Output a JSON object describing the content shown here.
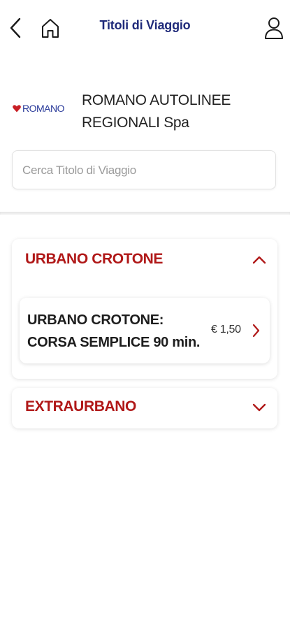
{
  "header": {
    "title": "Titoli di Viaggio",
    "back_icon": "chevron-left-icon",
    "home_icon": "home-icon",
    "user_icon": "user-icon"
  },
  "company": {
    "logo_text": "ROMANO",
    "name": "ROMANO AUTOLINEE REGIONALI Spa"
  },
  "search": {
    "placeholder": "Cerca Titolo di Viaggio",
    "value": ""
  },
  "categories": [
    {
      "title": "URBANO CROTONE",
      "expanded": true,
      "tickets": [
        {
          "name": "URBANO CROTONE: CORSA SEMPLICE 90 min.",
          "price": "€ 1,50"
        }
      ]
    },
    {
      "title": "EXTRAURBANO",
      "expanded": false,
      "tickets": []
    }
  ],
  "colors": {
    "title_blue": "#1f2a7a",
    "accent_red": "#b01818",
    "logo_blue": "#2a3a9a"
  }
}
